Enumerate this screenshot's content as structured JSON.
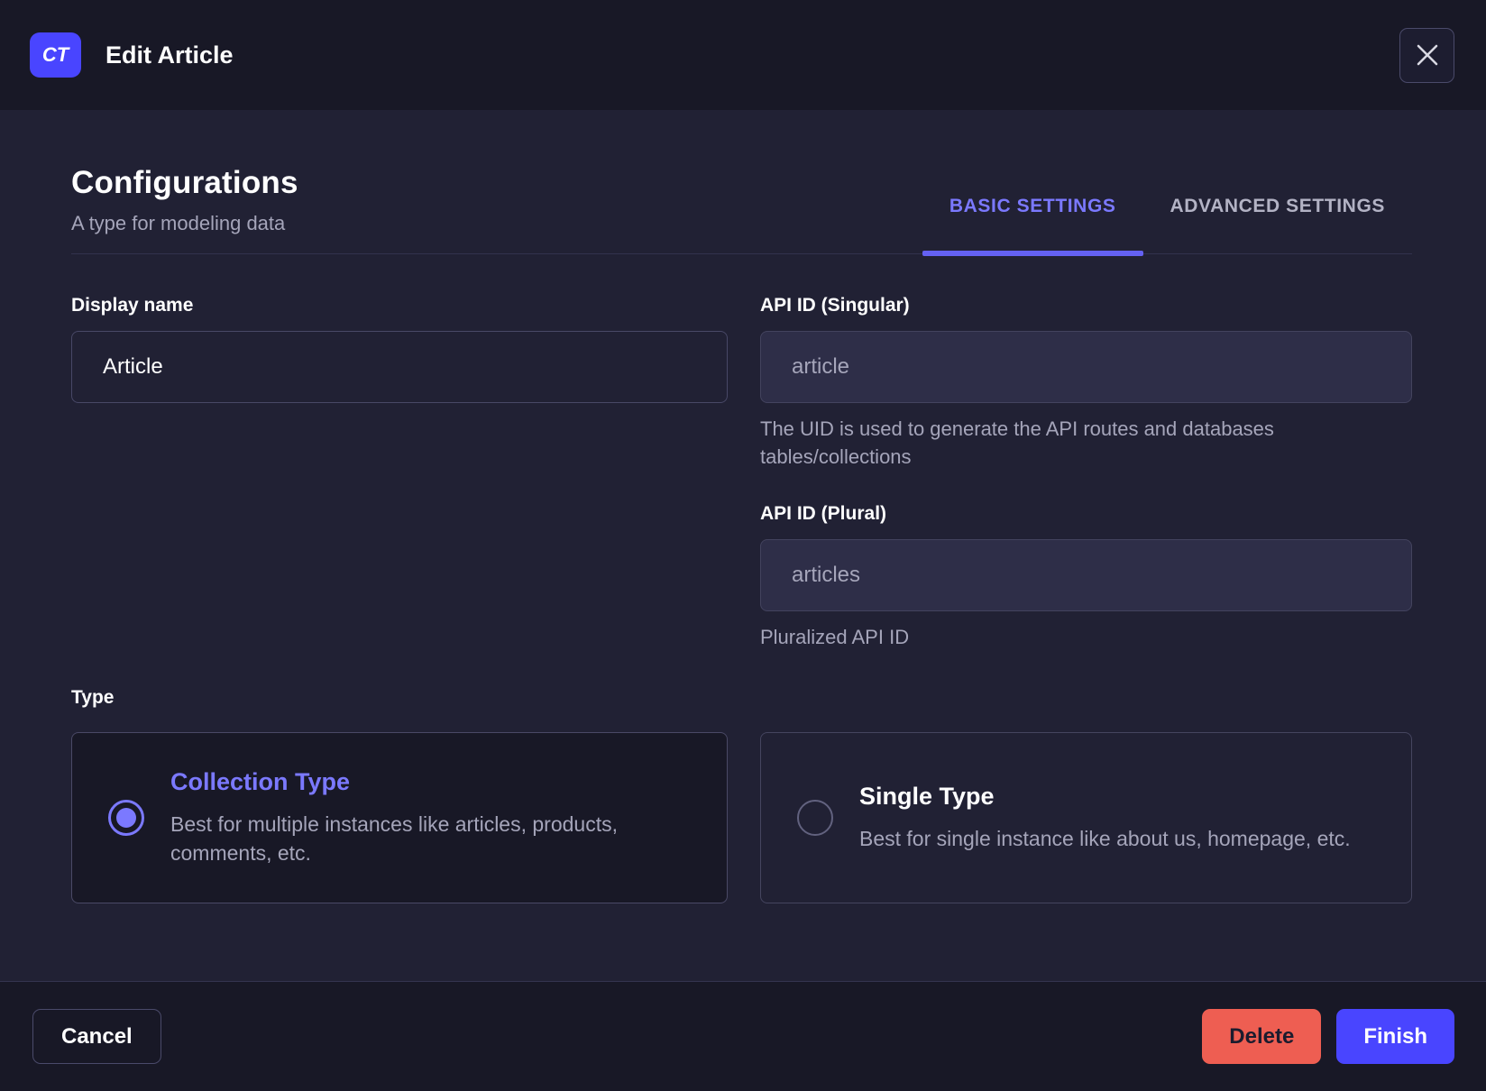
{
  "header": {
    "badge": "CT",
    "title": "Edit Article"
  },
  "config": {
    "title": "Configurations",
    "subtitle": "A type for modeling data",
    "tabs": [
      {
        "label": "BASIC SETTINGS",
        "active": true
      },
      {
        "label": "ADVANCED SETTINGS",
        "active": false
      }
    ]
  },
  "form": {
    "display_name": {
      "label": "Display name",
      "value": "Article"
    },
    "api_id_singular": {
      "label": "API ID (Singular)",
      "value": "article",
      "hint": "The UID is used to generate the API routes and databases tables/collections"
    },
    "api_id_plural": {
      "label": "API ID (Plural)",
      "value": "articles",
      "hint": "Pluralized API ID"
    },
    "type": {
      "label": "Type",
      "options": [
        {
          "title": "Collection Type",
          "description": "Best for multiple instances like articles, products, comments, etc.",
          "selected": true
        },
        {
          "title": "Single Type",
          "description": "Best for single instance like about us, homepage, etc.",
          "selected": false
        }
      ]
    }
  },
  "footer": {
    "cancel": "Cancel",
    "delete": "Delete",
    "finish": "Finish"
  },
  "colors": {
    "accent": "#4945ff",
    "accent_light": "#7b79ff",
    "danger": "#ee5e52",
    "bg_dark": "#181826",
    "bg_body": "#212134"
  }
}
